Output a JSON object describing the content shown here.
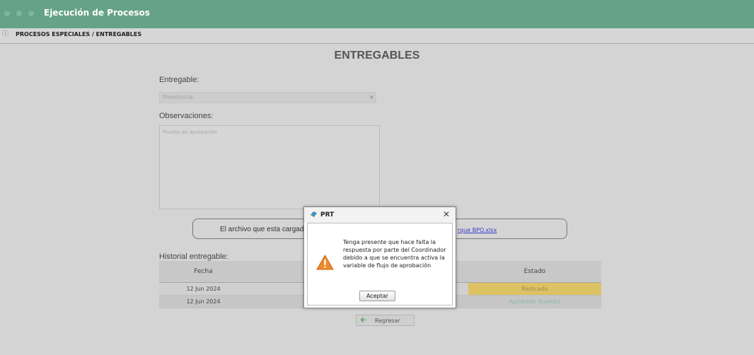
{
  "app": {
    "title": "Ejecución de Procesos"
  },
  "breadcrumb": {
    "icon": "info-icon",
    "text": "PROCESOS ESPECIALES / ENTREGABLES"
  },
  "page": {
    "title": "ENTREGABLES"
  },
  "form": {
    "entregable_label": "Entregable:",
    "entregable_value": "Prenómina",
    "observaciones_label": "Observaciones:",
    "observaciones_value": "Prueba de aprobación",
    "file_text": "El archivo que esta cargado",
    "file_link": "rque BPO.xlsx"
  },
  "history": {
    "label": "Historial entregable:",
    "columns": [
      "Fecha",
      "",
      "",
      "Estado"
    ],
    "rows": [
      {
        "fecha": "12 Jun 2024",
        "estado": "Radicado",
        "estado_color": "#dcc262"
      },
      {
        "fecha": "12 Jun 2024",
        "estado": "Aprobado Analista",
        "estado_color": "#54ad88"
      }
    ]
  },
  "buttons": {
    "regresar": "Regresar"
  },
  "dialog": {
    "title": "PRT",
    "message": "Tenga presente que hace falta la respuesta por parte del Coordinador debido a que se encuentra activa la variable de flujo de aprobación",
    "ok_label": "Aceptar",
    "icon": "warning-icon"
  }
}
